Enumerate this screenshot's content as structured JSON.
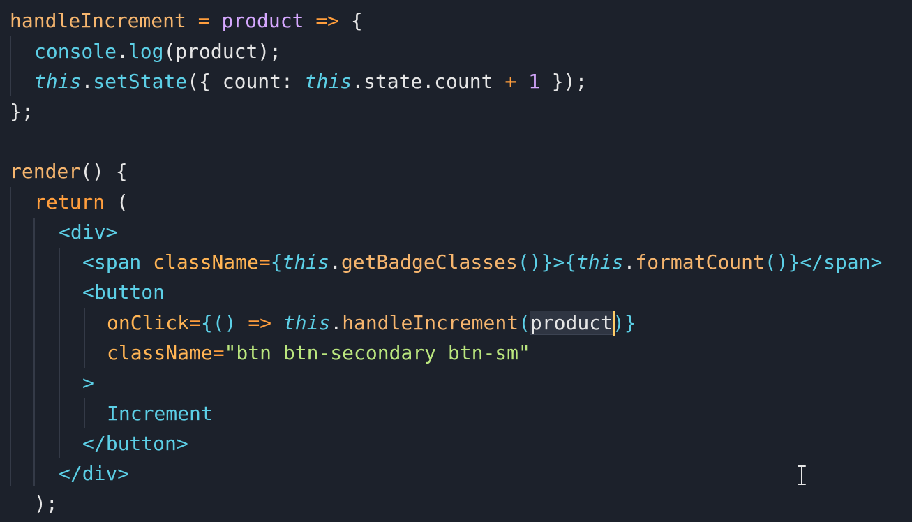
{
  "editor": {
    "colors": {
      "background": "#1c212b",
      "property": "#f5b56e",
      "parameter": "#d6a8ff",
      "operator": "#ff9e3d",
      "function": "#5ccfe6",
      "string": "#bae67e",
      "cursor": "#ffcc66"
    },
    "lines": [
      {
        "tokens": [
          "handleIncrement",
          " ",
          "=",
          " ",
          "product",
          " ",
          "=>",
          " {"
        ]
      },
      {
        "tokens": [
          "console",
          ".",
          "log",
          "(",
          "product",
          ");"
        ]
      },
      {
        "tokens": [
          "this",
          ".",
          "setState",
          "({ ",
          "count",
          ": ",
          "this",
          ".",
          "state",
          ".",
          "count",
          " ",
          "+",
          " ",
          "1",
          " });"
        ]
      },
      {
        "tokens": [
          "};"
        ]
      },
      {
        "tokens": []
      },
      {
        "tokens": [
          "render",
          "() {"
        ]
      },
      {
        "tokens": [
          "return",
          " ("
        ]
      },
      {
        "tokens": [
          "<div",
          ">"
        ]
      },
      {
        "tokens": [
          "<span",
          " ",
          "className",
          "=",
          "{",
          "this",
          ".",
          "getBadgeClasses",
          "()",
          "}",
          ">",
          "{",
          "this",
          ".",
          "formatCount",
          "()",
          "}",
          "</span",
          ">"
        ]
      },
      {
        "tokens": [
          "<button"
        ]
      },
      {
        "tokens": [
          "onClick",
          "=",
          "{",
          "() ",
          "=>",
          " ",
          "this",
          ".",
          "handleIncrement",
          "(",
          "product",
          ")",
          "}"
        ]
      },
      {
        "tokens": [
          "className",
          "=",
          "\"btn btn-secondary btn-sm\""
        ]
      },
      {
        "tokens": [
          ">"
        ]
      },
      {
        "tokens": [
          "Increment"
        ]
      },
      {
        "tokens": [
          "</button",
          ">"
        ]
      },
      {
        "tokens": [
          "</div",
          ">"
        ]
      },
      {
        "tokens": [
          ");"
        ]
      }
    ],
    "mouse_cursor_icon": "text-ibeam-cursor-icon"
  }
}
